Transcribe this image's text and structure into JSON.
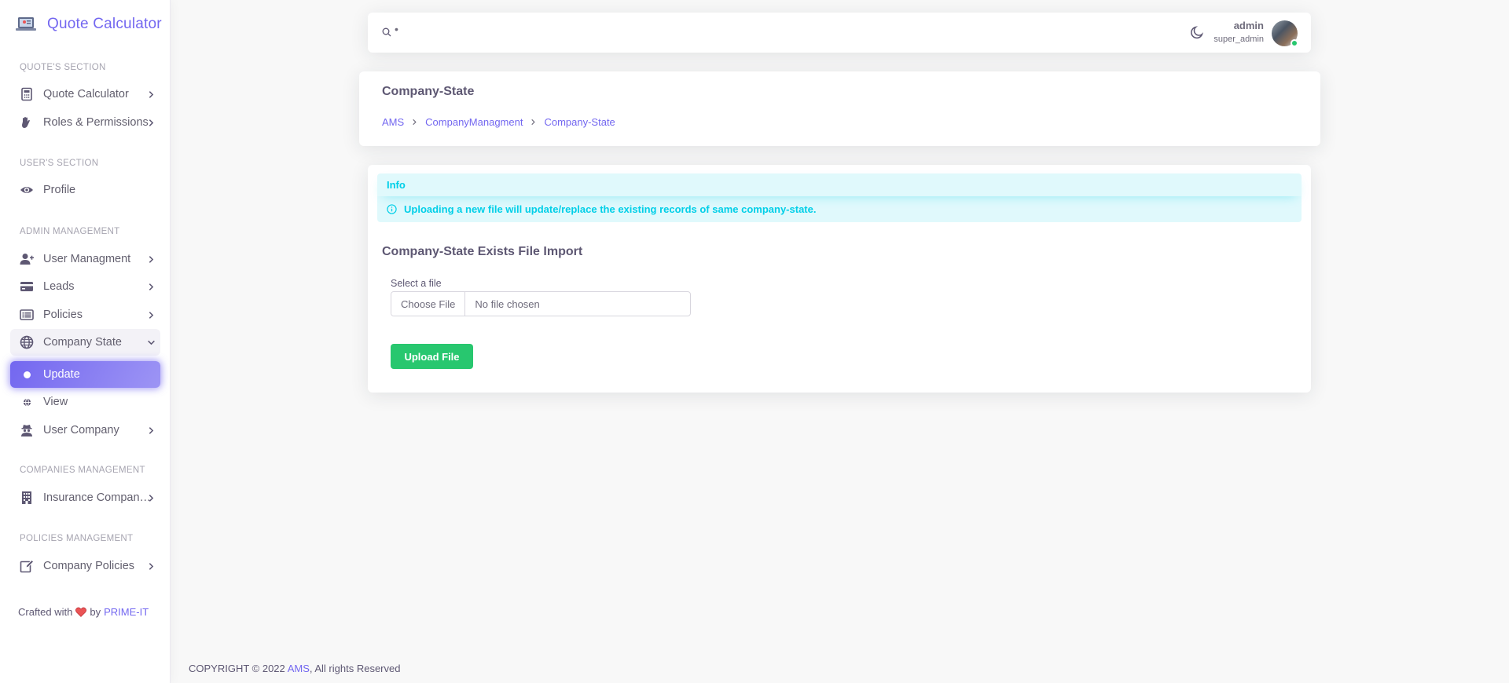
{
  "brand": {
    "title": "Quote Calculator",
    "icon": "laptop-logo-icon"
  },
  "sidebar": {
    "sections": [
      {
        "header": "QUOTE'S SECTION"
      },
      {
        "header": "USER'S SECTION"
      },
      {
        "header": "ADMIN MANAGEMENT"
      },
      {
        "header": "COMPANIES MANAGEMENT"
      },
      {
        "header": "POLICIES MANAGEMENT"
      }
    ],
    "items": [
      {
        "label": "Quote Calculator",
        "icon": "calculator-icon"
      },
      {
        "label": "Roles & Permissions",
        "icon": "hand-icon"
      },
      {
        "label": "Profile",
        "icon": "eye-icon"
      },
      {
        "label": "User Managment",
        "icon": "user-plus-icon"
      },
      {
        "label": "Leads",
        "icon": "credit-card-icon"
      },
      {
        "label": "Policies",
        "icon": "list-icon"
      },
      {
        "label": "Company State",
        "icon": "globe-icon"
      },
      {
        "label": "Update",
        "icon": "circle-icon"
      },
      {
        "label": "View",
        "icon": "globe-small-icon"
      },
      {
        "label": "User Company",
        "icon": "user-secret-icon"
      },
      {
        "label": "Insurance Companies",
        "icon": "building-icon"
      },
      {
        "label": "Company Policies",
        "icon": "edit-icon"
      }
    ],
    "footer": {
      "prefix": "Crafted with",
      "by": "by",
      "link": "PRIME-IT"
    }
  },
  "navbar": {
    "search_text": "•",
    "user_name": "admin",
    "user_role": "super_admin"
  },
  "header": {
    "title": "Company-State",
    "breadcrumb": [
      "AMS",
      "CompanyManagment",
      "Company-State"
    ]
  },
  "main": {
    "alert": {
      "heading": "Info",
      "message": "Uploading a new file will update/replace the existing records of same company-state."
    },
    "import_title": "Company-State Exists File Import",
    "file_label": "Select a file",
    "file_button": "Choose File",
    "file_status": "No file chosen",
    "upload_button": "Upload File"
  },
  "footer": {
    "prefix": "COPYRIGHT © 2022",
    "link": "AMS",
    "suffix": ", All rights Reserved"
  },
  "colors": {
    "primary": "#7367f0",
    "success": "#28c76f",
    "info": "#00cfe8",
    "heart": "#ea5455"
  }
}
